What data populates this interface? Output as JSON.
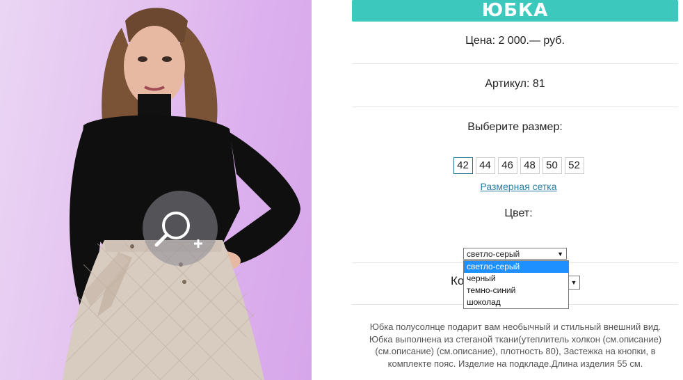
{
  "product": {
    "title": "ЮБКА",
    "price": "Цена: 2 000.— руб.",
    "sku": "Артикул: 81",
    "size_label": "Выберите размер:",
    "sizes": [
      "42",
      "44",
      "46",
      "48",
      "50",
      "52"
    ],
    "selected_size": "42",
    "size_chart_link": "Размерная сетка",
    "color_label": "Цвет:",
    "color_select": {
      "value": "светло-серый",
      "options": [
        "светло-серый",
        "черный",
        "темно-синий",
        "шоколад"
      ]
    },
    "quantity_label_partial": "Ко",
    "description": "Юбка полусолнце подарит вам необычный и стильный внешний вид. Юбка выполнена из стеганой ткани(утеплитель холкон (см.описание) (см.описание) (см.описание), плотность 80), Застежка на кнопки, в комплекте пояс. Изделие на подкладе.Длина изделия 55 см."
  },
  "icons": {
    "zoom": "zoom-in-icon",
    "select_arrow": "chevron-down-icon"
  },
  "colors": {
    "accent": "#3cc8bd",
    "link": "#2a7ea6",
    "dropdown_highlight": "#1e90ff"
  }
}
